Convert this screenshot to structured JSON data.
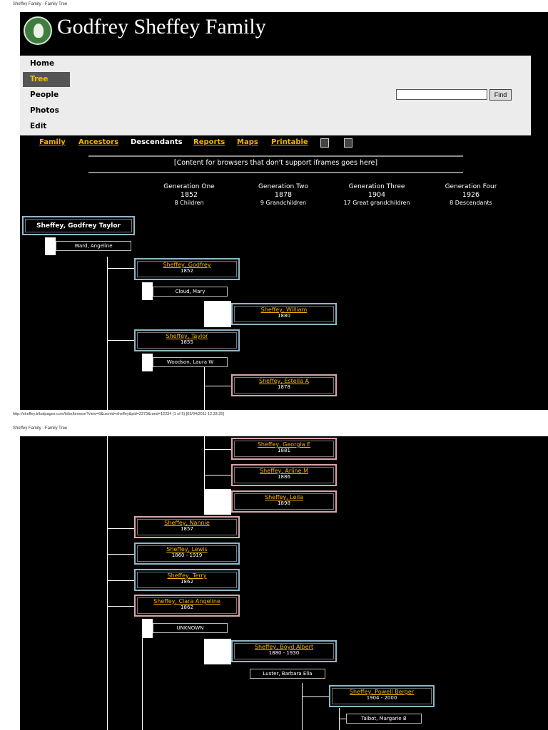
{
  "browser": {
    "page_title": "Sheffey Family - Family Tree",
    "footer": "http://sheffey.tribalpages.com/tribe/browse?view=6&userid=sheffey&pid=2373&rand=12234 (1 of 5) [03/04/2011 12:33:25]"
  },
  "site": {
    "title": "Godfrey Sheffey Family",
    "logo_icon": "tree-logo-icon"
  },
  "nav": {
    "items": [
      {
        "label": "Home",
        "active": false
      },
      {
        "label": "Tree",
        "active": true
      },
      {
        "label": "People",
        "active": false
      },
      {
        "label": "Photos",
        "active": false
      },
      {
        "label": "Edit",
        "active": false
      }
    ],
    "search_value": "",
    "find_label": "Find"
  },
  "subnav": {
    "items": [
      {
        "label": "Family",
        "current": false
      },
      {
        "label": "Ancestors",
        "current": false
      },
      {
        "label": "Descendants",
        "current": true
      },
      {
        "label": "Reports",
        "current": false
      },
      {
        "label": "Maps",
        "current": false
      },
      {
        "label": "Printable",
        "current": false
      }
    ],
    "icons": [
      "print-icon",
      "edit-icon"
    ]
  },
  "iframe_note": "[Content for browsers that don't support iframes goes here]",
  "generations": [
    {
      "label": "Generation One",
      "year": "1852",
      "sub": "8 Children"
    },
    {
      "label": "Generation Two",
      "year": "1878",
      "sub": "9 Grandchildren"
    },
    {
      "label": "Generation Three",
      "year": "1904",
      "sub": "17 Great grandchildren"
    },
    {
      "label": "Generation Four",
      "year": "1926",
      "sub": "8 Descendants"
    }
  ],
  "tree": {
    "root": "Sheffey, Godfrey Taylor",
    "root_spouse": "Ward, Angeline",
    "people": [
      {
        "name": "Sheffey, Godfrey",
        "dates": "1852"
      },
      {
        "name": "Cloud, Mary"
      },
      {
        "name": "Sheffey, William",
        "dates": "1880"
      },
      {
        "name": "Sheffey, Taylor",
        "dates": "1855"
      },
      {
        "name": "Woodson, Laura W"
      },
      {
        "name": "Sheffey, Estella A",
        "dates": "1878"
      },
      {
        "name": "Sheffey, Georgia E",
        "dates": "1881"
      },
      {
        "name": "Sheffey, Arline M",
        "dates": "1886"
      },
      {
        "name": "Sheffey, Leila",
        "dates": "1898"
      },
      {
        "name": "Sheffey, Nannie",
        "dates": "1857"
      },
      {
        "name": "Sheffey, Lewis",
        "dates": "1860 - 1919"
      },
      {
        "name": "Sheffey, Terry",
        "dates": "1862"
      },
      {
        "name": "Sheffey, Clara Angeline",
        "dates": "1862"
      },
      {
        "name": "UNKNOWN"
      },
      {
        "name": "Sheffey, Boyd Albert",
        "dates": "1880 - 1930"
      },
      {
        "name": "Luster, Barbara Ella"
      },
      {
        "name": "Sheffey, Powell Berger",
        "dates": "1904 - 2000"
      },
      {
        "name": "Talbot, Margarie B"
      }
    ]
  },
  "colors": {
    "male_border": "#8fb6c8",
    "female_border": "#dba3a8",
    "link": "#f5b400",
    "active_nav_bg": "#555555"
  }
}
